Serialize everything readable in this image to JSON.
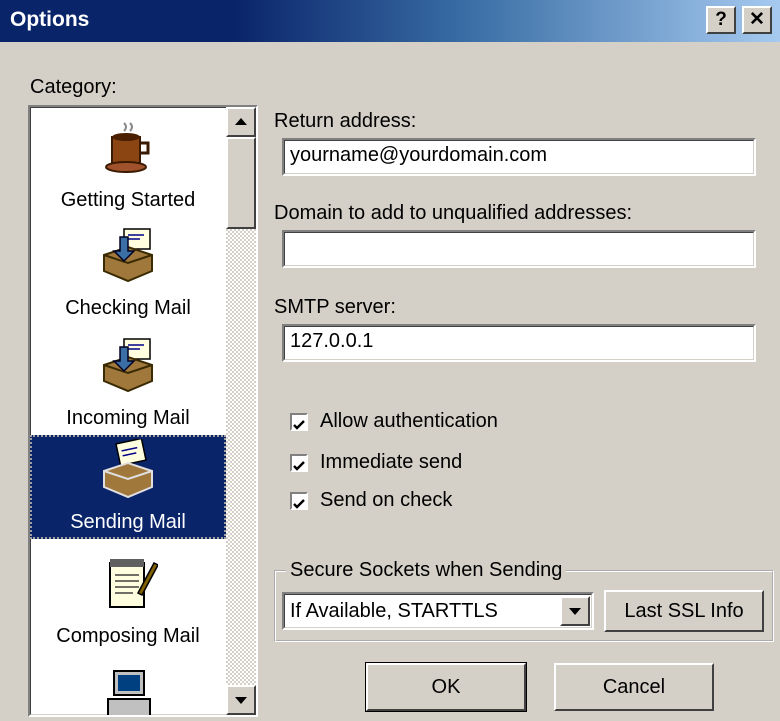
{
  "window": {
    "title": "Options",
    "help_glyph": "?",
    "close_glyph": "✕"
  },
  "category": {
    "label": "Category:",
    "items": [
      {
        "label": "Getting Started",
        "icon": "coffee-cup-icon"
      },
      {
        "label": "Checking Mail",
        "icon": "mail-tray-icon"
      },
      {
        "label": "Incoming Mail",
        "icon": "mail-tray-icon"
      },
      {
        "label": "Sending Mail",
        "icon": "outgoing-mail-icon",
        "selected": true
      },
      {
        "label": "Composing Mail",
        "icon": "notepad-pen-icon"
      },
      {
        "label": "",
        "icon": "computer-icon"
      }
    ]
  },
  "form": {
    "return_address_label": "Return address:",
    "return_address_value": "yourname@yourdomain.com",
    "domain_label": "Domain to add to unqualified addresses:",
    "domain_value": "",
    "smtp_label": "SMTP server:",
    "smtp_value": "127.0.0.1"
  },
  "checkboxes": [
    {
      "label": "Allow authentication",
      "checked": true
    },
    {
      "label": "Immediate send",
      "checked": true
    },
    {
      "label": "Send on check",
      "checked": true
    }
  ],
  "ssl": {
    "group_label": "Secure Sockets when Sending",
    "selected": "If Available, STARTTLS",
    "info_button": "Last SSL Info"
  },
  "buttons": {
    "ok": "OK",
    "cancel": "Cancel"
  },
  "colors": {
    "titlebar": "#0a246a",
    "selection": "#0a246a",
    "face": "#d4d0c8"
  }
}
